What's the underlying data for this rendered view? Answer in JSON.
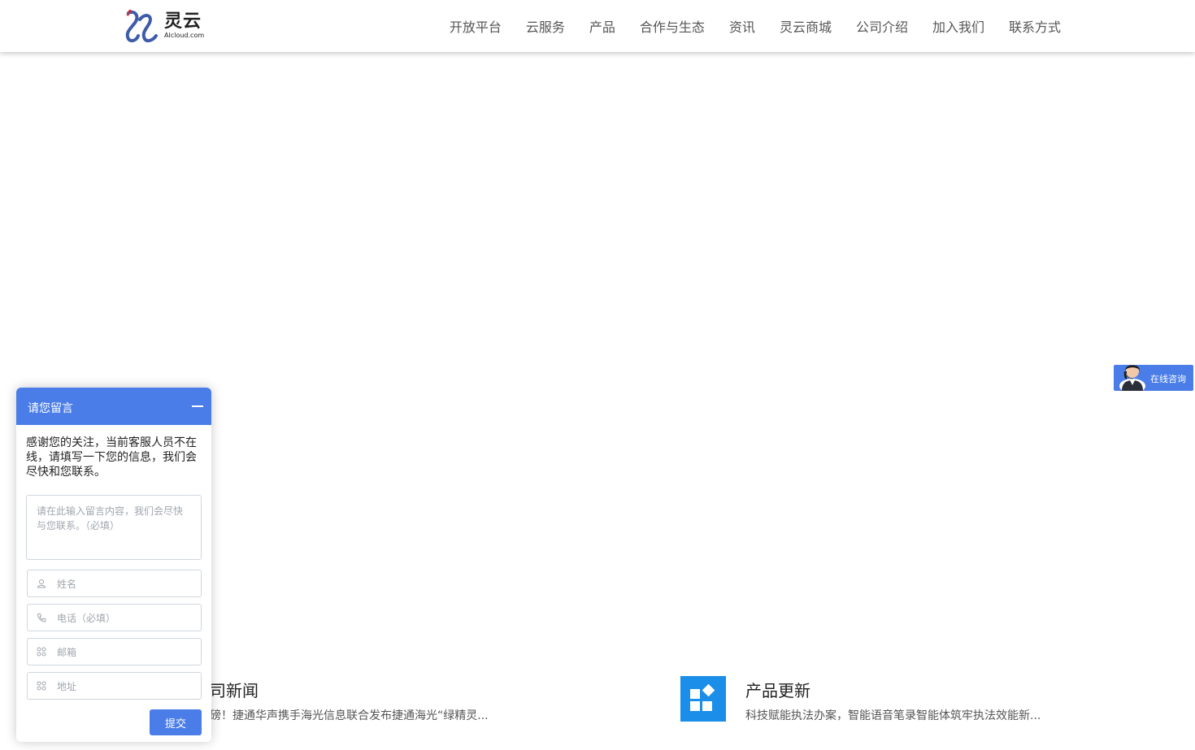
{
  "header": {
    "logo": {
      "cn": "灵云",
      "en": "AIcloud.com"
    },
    "nav": [
      {
        "label": "开放平台"
      },
      {
        "label": "云服务"
      },
      {
        "label": "产品"
      },
      {
        "label": "合作与生态"
      },
      {
        "label": "资讯"
      },
      {
        "label": "灵云商城"
      },
      {
        "label": "公司介绍"
      },
      {
        "label": "加入我们"
      },
      {
        "label": "联系方式"
      }
    ]
  },
  "consult": {
    "label": "在线咨询"
  },
  "news": {
    "company": {
      "title": "公司新闻",
      "visible_title": "司新闻",
      "desc": "磅！捷通华声携手海光信息联合发布捷通海光“绿精灵..."
    },
    "product": {
      "title": "产品更新",
      "desc": "科技赋能执法办案，智能语音笔录智能体筑牢执法效能新..."
    }
  },
  "message_widget": {
    "title": "请您留言",
    "intro": "感谢您的关注，当前客服人员不在线，请填写一下您的信息，我们会尽快和您联系。",
    "textarea_placeholder": "请在此输入留言内容，我们会尽快与您联系。（必填）",
    "fields": [
      {
        "placeholder": "姓名",
        "icon": "user-icon"
      },
      {
        "placeholder": "电话（必填）",
        "icon": "phone-icon"
      },
      {
        "placeholder": "邮箱",
        "icon": "grid-icon"
      },
      {
        "placeholder": "地址",
        "icon": "grid-icon"
      }
    ],
    "submit_label": "提交"
  },
  "colors": {
    "accent": "#4a7de8",
    "product_icon": "#1a8ee8",
    "logo_blue": "#3d5ca8",
    "logo_red": "#d8232a"
  }
}
